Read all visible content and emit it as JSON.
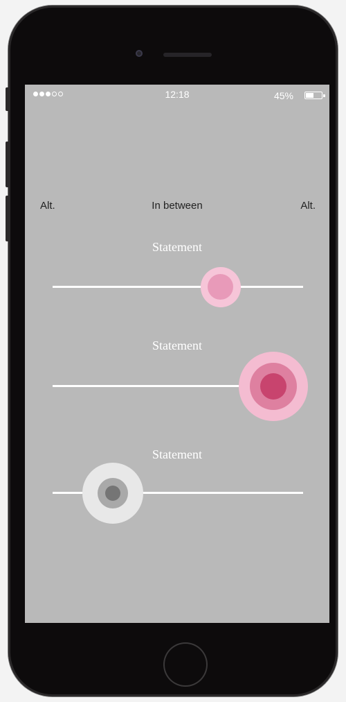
{
  "status_bar": {
    "signal_filled": 3,
    "signal_total": 5,
    "time": "12:18",
    "battery_percent": "45%",
    "battery_level": 0.45
  },
  "scale_labels": {
    "left": "Alt.",
    "center": "In between",
    "right": "Alt."
  },
  "sliders": [
    {
      "label": "Statement",
      "value_fraction": 0.67,
      "thumb_size": "small",
      "thumb_color": "#e89ab9",
      "ring_color": "#f6c5d8"
    },
    {
      "label": "Statement",
      "value_fraction": 0.88,
      "thumb_size": "large",
      "thumb_color": "#c8446e",
      "ring_color": "#f4bcd1"
    },
    {
      "label": "Statement",
      "value_fraction": 0.24,
      "thumb_size": "medium",
      "thumb_color": "#757575",
      "ring_color": "#e8e8e8"
    }
  ],
  "colors": {
    "screen_background": "#b9b9b9",
    "phone_body": "#0d0b0c",
    "track": "#ffffff"
  }
}
